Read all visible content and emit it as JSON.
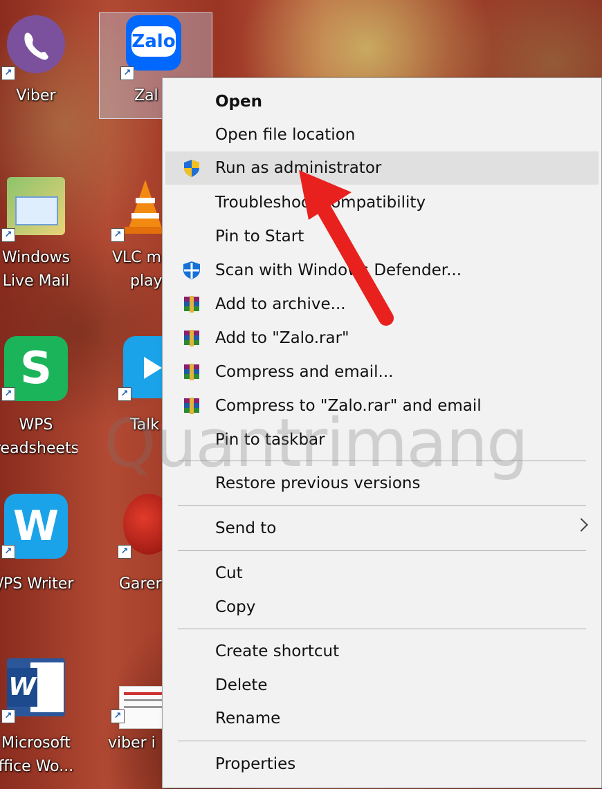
{
  "desktop": {
    "icons": [
      {
        "label": "Viber"
      },
      {
        "label": "Zal"
      },
      {
        "label": "Windows"
      },
      {
        "label": "Live Mail"
      },
      {
        "label": "VLC m"
      },
      {
        "label": "play"
      },
      {
        "label": "WPS"
      },
      {
        "label": "readsheets"
      },
      {
        "label": "Talk"
      },
      {
        "label": "/PS Writer"
      },
      {
        "label": "Garer"
      },
      {
        "label": "Microsoft"
      },
      {
        "label": "ffice Wo..."
      },
      {
        "label": "viber i"
      }
    ],
    "zalo_tile_text": "Zalo",
    "wps_s_text": "S",
    "w_text": "W"
  },
  "context_menu": {
    "items": [
      {
        "label": "Open"
      },
      {
        "label": "Open file location"
      },
      {
        "label": "Run as administrator"
      },
      {
        "label": "Troubleshoot compatibility"
      },
      {
        "label": "Pin to Start"
      },
      {
        "label": "Scan with Windows Defender..."
      },
      {
        "label": "Add to archive..."
      },
      {
        "label": "Add to \"Zalo.rar\""
      },
      {
        "label": "Compress and email..."
      },
      {
        "label": "Compress to \"Zalo.rar\" and email"
      },
      {
        "label": "Pin to taskbar"
      },
      {
        "label": "Restore previous versions"
      },
      {
        "label": "Send to"
      },
      {
        "label": "Cut"
      },
      {
        "label": "Copy"
      },
      {
        "label": "Create shortcut"
      },
      {
        "label": "Delete"
      },
      {
        "label": "Rename"
      },
      {
        "label": "Properties"
      }
    ]
  },
  "watermark": "Quantrimang",
  "colors": {
    "menu_bg": "#f2f2f2",
    "highlight": "#e0e0e0",
    "arrow": "#e8211e",
    "viber": "#7b519d",
    "zalo": "#0068ff",
    "wps_green": "#1bb45a",
    "wps_blue": "#1aa3e8"
  }
}
